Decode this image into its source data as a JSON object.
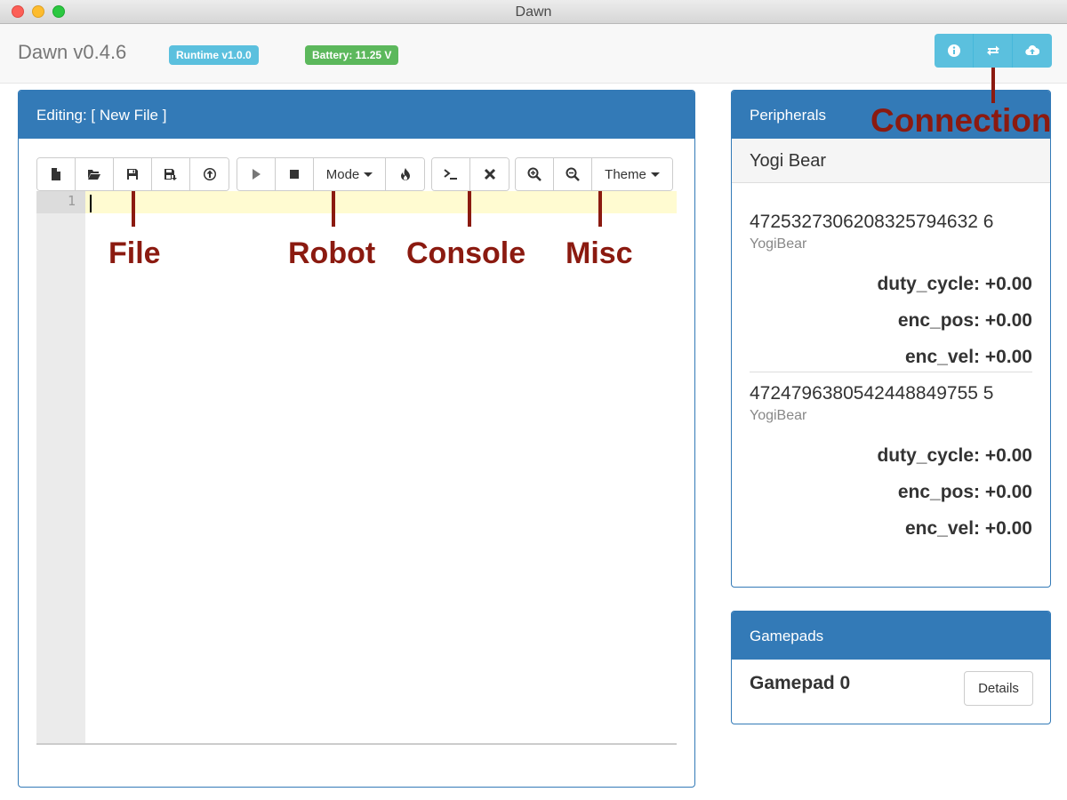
{
  "window": {
    "title": "Dawn"
  },
  "header": {
    "brand": "Dawn v0.4.6",
    "runtime_badge": "Runtime v1.0.0",
    "battery_badge": "Battery: 11.25 V",
    "connection_buttons": [
      {
        "icon": "info-icon"
      },
      {
        "icon": "exchange-icon"
      },
      {
        "icon": "cloud-upload-icon"
      }
    ]
  },
  "editor": {
    "heading": "Editing: [ New File ]",
    "toolbar": {
      "file_buttons": [
        {
          "icon": "new-file-icon"
        },
        {
          "icon": "open-folder-icon"
        },
        {
          "icon": "save-icon"
        },
        {
          "icon": "save-as-icon"
        },
        {
          "icon": "upload-icon"
        }
      ],
      "robot_buttons": [
        {
          "icon": "play-icon"
        },
        {
          "icon": "stop-icon"
        },
        {
          "label": "Mode"
        },
        {
          "icon": "fire-icon"
        }
      ],
      "console_buttons": [
        {
          "icon": "terminal-icon"
        },
        {
          "icon": "clear-icon"
        }
      ],
      "misc_buttons": [
        {
          "icon": "zoom-in-icon"
        },
        {
          "icon": "zoom-out-icon"
        },
        {
          "label": "Theme"
        }
      ]
    },
    "line_number": "1"
  },
  "annotations": {
    "file": "File",
    "robot": "Robot",
    "console": "Console",
    "misc": "Misc",
    "connection": "Connection"
  },
  "peripherals": {
    "heading": "Peripherals",
    "device_name": "Yogi Bear",
    "devices": [
      {
        "id": "4725327306208325794632 6",
        "type": "YogiBear",
        "params": [
          "duty_cycle: +0.00",
          "enc_pos: +0.00",
          "enc_vel: +0.00"
        ]
      },
      {
        "id": "4724796380542448849755 5",
        "type": "YogiBear",
        "params": [
          "duty_cycle: +0.00",
          "enc_pos: +0.00",
          "enc_vel: +0.00"
        ]
      }
    ]
  },
  "gamepads": {
    "heading": "Gamepads",
    "items": [
      {
        "name": "Gamepad 0",
        "details_label": "Details"
      }
    ]
  },
  "colors": {
    "primary": "#337ab7",
    "info": "#5bc0de",
    "success": "#5cb85c",
    "annotation": "#8b1a10",
    "active_line": "#fffbd1"
  }
}
